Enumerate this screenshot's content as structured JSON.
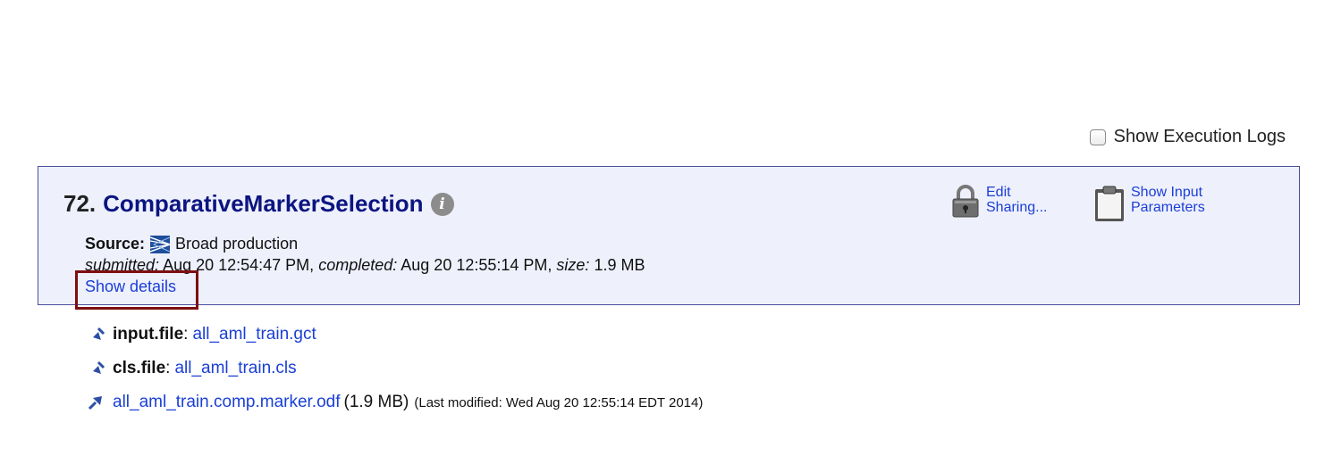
{
  "exec_logs": {
    "label": "Show Execution Logs",
    "checked": false
  },
  "job": {
    "number": "72.",
    "name": "ComparativeMarkerSelection",
    "source_label": "Source:",
    "source_value": "Broad production",
    "submitted_label": "submitted:",
    "submitted_value": "Aug 20 12:54:47 PM,",
    "completed_label": "completed:",
    "completed_value": "Aug 20 12:55:14 PM,",
    "size_label": "size:",
    "size_value": "1.9 MB",
    "show_details": "Show details",
    "actions": {
      "edit_line1": "Edit",
      "edit_line2": "Sharing...",
      "params_line1": "Show Input",
      "params_line2": "Parameters"
    }
  },
  "inputs": [
    {
      "label": "input.file",
      "sep": ":",
      "link": "all_aml_train.gct"
    },
    {
      "label": "cls.file",
      "sep": ":",
      "link": "all_aml_train.cls"
    }
  ],
  "output": {
    "link": "all_aml_train.comp.marker.odf",
    "size": "(1.9 MB)",
    "modified": "(Last modified: Wed Aug 20 12:55:14 EDT 2014)"
  },
  "colors": {
    "panel_bg": "#eef0fc",
    "panel_border": "#4b4f9c",
    "title": "#0b1580",
    "link": "#1a3fd6",
    "highlight": "#7d0f11"
  }
}
